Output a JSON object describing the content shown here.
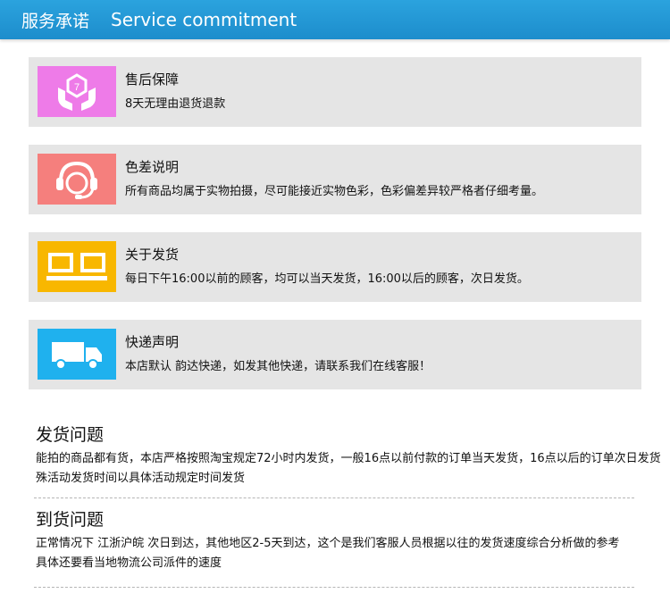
{
  "header": {
    "title_cn": "服务承诺",
    "title_en": "Service commitment",
    "bg_color": "#2098d6"
  },
  "cards": [
    {
      "title": "售后保障",
      "desc": "8天无理由退货退款",
      "icon": "hands-box-icon",
      "color": "#ee7be8"
    },
    {
      "title": "色差说明",
      "desc": "所有商品均属于实物拍摄，尽可能接近实物色彩，色彩偏差异较严格者仔细考量。",
      "icon": "headset-agent-icon",
      "color": "#f57f7d"
    },
    {
      "title": "关于发货",
      "desc": "每日下午16:00以前的顾客，均可以当天发货，16:00以后的顾客，次日发货。",
      "icon": "delivery-box-icon",
      "color": "#f8b700"
    },
    {
      "title": "快递声明",
      "desc": "本店默认 韵达快递，如发其他快递，请联系我们在线客服！",
      "icon": "truck-icon",
      "color": "#1fb1ee"
    }
  ],
  "sections": [
    {
      "title": "发货问题",
      "lines": [
        "能拍的商品都有货，本店严格按照淘宝规定72小时内发货，一般16点以前付款的订单当天发货，16点以后的订单次日发货",
        "殊活动发货时间以具体活动规定时间发货"
      ]
    },
    {
      "title": "到货问题",
      "lines": [
        "正常情况下 江浙沪皖 次日到达，其他地区2-5天到达，这个是我们客服人员根据以往的发货速度综合分析做的参考",
        "具体还要看当地物流公司派件的速度"
      ]
    }
  ]
}
